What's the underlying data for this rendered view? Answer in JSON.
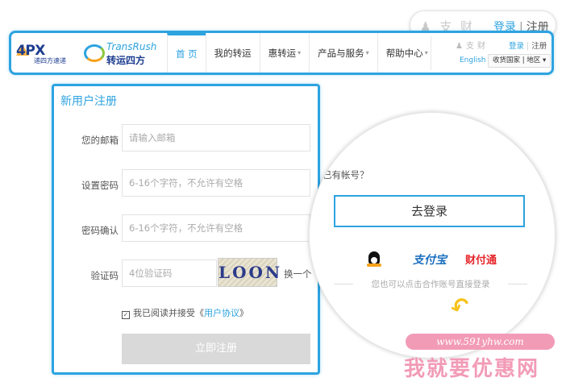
{
  "header": {
    "logo_4px": {
      "brand": "4PX",
      "sub": "递四方速递"
    },
    "logo_transrush": {
      "en": "TransRush",
      "cn": "转运四方"
    },
    "nav": [
      {
        "label": "首 页",
        "active": true,
        "caret": false
      },
      {
        "label": "我的转运",
        "active": false,
        "caret": false
      },
      {
        "label": "惠转运",
        "active": false,
        "caret": true
      },
      {
        "label": "产品与服务",
        "active": false,
        "caret": true
      },
      {
        "label": "帮助中心",
        "active": false,
        "caret": true
      }
    ],
    "login_label": "登录",
    "register_label": "注册",
    "english_label": "English",
    "region_label": "收货国家 | 地区 ▾"
  },
  "zoom_top": {
    "login_label": "登录",
    "register_label": "注册"
  },
  "form": {
    "title": "新用户注册",
    "email": {
      "label": "您的邮箱",
      "placeholder": "请输入邮箱"
    },
    "password": {
      "label": "设置密码",
      "placeholder": "6-16个字符，不允许有空格"
    },
    "confirm": {
      "label": "密码确认",
      "placeholder": "6-16个字符，不允许有空格"
    },
    "captcha": {
      "label": "验证码",
      "placeholder": "4位验证码",
      "image_text": "LOON",
      "refresh_label": "换一个"
    },
    "agree": {
      "prefix": "我已阅读并接受《",
      "link": "用户协议",
      "suffix": "》",
      "checked": true
    },
    "submit_label": "立即注册"
  },
  "login_panel": {
    "has_account": "已有帐号？",
    "go_login": "去登录",
    "alipay_label": "支付宝",
    "caifu_label": "财付通",
    "hint": "您也可以点击合作账号直接登录"
  },
  "watermark": {
    "url": "www.591yhw.com",
    "name": "我就要优惠网"
  },
  "colors": {
    "accent": "#2da3e0",
    "brand_red": "#e6262b",
    "brand_navy": "#1b3c8f",
    "watermark": "#f29bb7"
  }
}
